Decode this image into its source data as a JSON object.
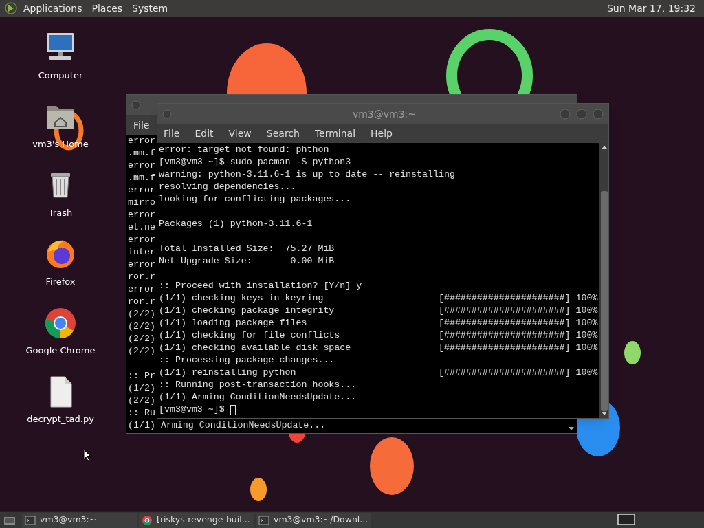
{
  "top_panel": {
    "menus": [
      "Applications",
      "Places",
      "System"
    ],
    "clock": "Sun Mar 17, 19:32"
  },
  "desktop_icons": [
    {
      "kind": "computer",
      "label": "Computer"
    },
    {
      "kind": "folder",
      "label": "vm3's Home"
    },
    {
      "kind": "trash",
      "label": "Trash"
    },
    {
      "kind": "firefox",
      "label": "Firefox"
    },
    {
      "kind": "chrome",
      "label": "Google Chrome"
    },
    {
      "kind": "file",
      "label": "decrypt_tad.py"
    }
  ],
  "back_window": {
    "menu": [
      "File"
    ],
    "blocks": [
      [
        "error",
        ".mm.f",
        "error",
        ".mm.f",
        "error",
        "mirro",
        "error",
        "et.ne",
        "error",
        "inter",
        "error",
        "ror.r",
        "error",
        "ror.r",
        "(2/2)",
        "(2/2)",
        "(2/2)",
        "(2/2)"
      ],
      [
        ":: Pr",
        "(1/2)",
        "(2/2)",
        ":: Ru",
        "(1/1) Arming ConditionNeedsUpdate..."
      ]
    ]
  },
  "terminal": {
    "title": "vm3@vm3:~",
    "menu": [
      "File",
      "Edit",
      "View",
      "Search",
      "Terminal",
      "Help"
    ],
    "blocks": [
      [
        "error: target not found: phthon",
        "[vm3@vm3 ~]$ sudo pacman -S python3",
        "warning: python-3.11.6-1 is up to date -- reinstalling",
        "resolving dependencies...",
        "looking for conflicting packages..."
      ],
      [
        "Packages (1) python-3.11.6-1"
      ],
      [
        "Total Installed Size:  75.27 MiB",
        "Net Upgrade Size:       0.00 MiB"
      ],
      [
        ":: Proceed with installation? [Y/n] y",
        "(1/1) checking keys in keyring                     [######################] 100%",
        "(1/1) checking package integrity                   [######################] 100%",
        "(1/1) loading package files                        [######################] 100%",
        "(1/1) checking for file conflicts                  [######################] 100%",
        "(1/1) checking available disk space                [######################] 100%",
        ":: Processing package changes...",
        "(1/1) reinstalling python                          [######################] 100%",
        ":: Running post-transaction hooks...",
        "(1/1) Arming ConditionNeedsUpdate..."
      ]
    ],
    "prompt": "[vm3@vm3 ~]$ "
  },
  "taskbar": {
    "items": [
      {
        "kind": "terminal",
        "label": "vm3@vm3:~"
      },
      {
        "kind": "chrome",
        "label": "[riskys-revenge-buil..."
      },
      {
        "kind": "terminal",
        "label": "vm3@vm3:~/Downl..."
      }
    ]
  }
}
